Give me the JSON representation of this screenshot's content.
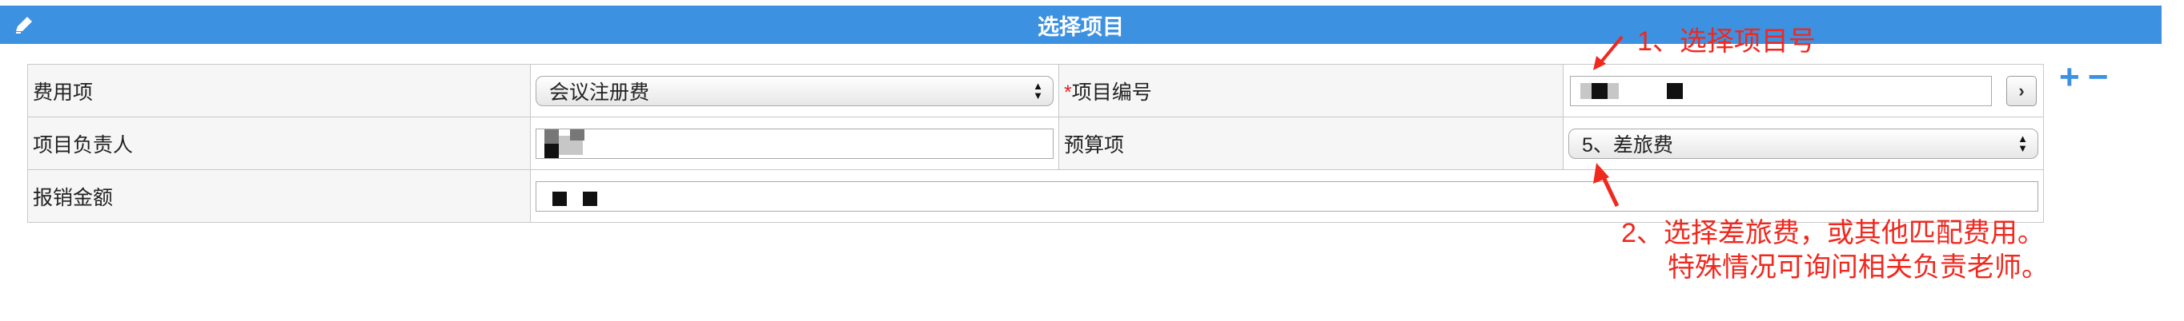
{
  "dialog": {
    "title": "选择项目"
  },
  "form": {
    "row1": {
      "label1": "费用项",
      "select1": "会议注册费",
      "required_mark": "*",
      "label2": "项目编号",
      "pick_button": "›"
    },
    "row2": {
      "label1": "项目负责人",
      "label2": "预算项",
      "select2": "5、差旅费"
    },
    "row3": {
      "label1": "报销金额"
    }
  },
  "row_actions": {
    "add": "+",
    "remove": "−"
  },
  "annotations": {
    "note1": "1、选择项目号",
    "note2_line1": "2、选择差旅费，或其他匹配费用。",
    "note2_line2": "特殊情况可询问相关负责老师。"
  },
  "colors": {
    "header": "#3d91e1",
    "annotation": "#f0281e"
  }
}
